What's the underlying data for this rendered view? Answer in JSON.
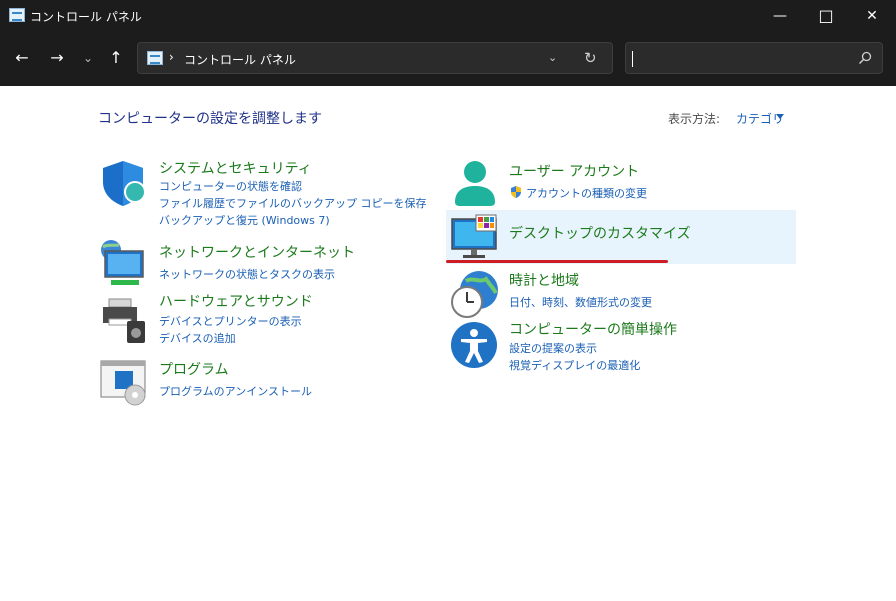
{
  "window": {
    "title": "コントロール パネル",
    "minimize_glyph": "—",
    "maximize_glyph": "□",
    "close_glyph": "✕"
  },
  "toolbar": {
    "back_glyph": "←",
    "forward_glyph": "→",
    "recent_glyph": "⌄",
    "up_glyph": "↑",
    "breadcrumb": "コントロール パネル",
    "breadcrumb_separator": "›",
    "dropdown_glyph": "⌄",
    "refresh_glyph": "↻",
    "search_value": ""
  },
  "content": {
    "heading": "コンピューターの設定を調整します",
    "view_by_label": "表示方法:",
    "view_by_value": "カテゴリ"
  },
  "categories_left": [
    {
      "title": "システムとセキュリティ",
      "icon": "shield-icon",
      "links": [
        "コンピューターの状態を確認",
        "ファイル履歴でファイルのバックアップ コピーを保存",
        "バックアップと復元 (Windows 7)"
      ]
    },
    {
      "title": "ネットワークとインターネット",
      "icon": "network-icon",
      "links": [
        "ネットワークの状態とタスクの表示"
      ]
    },
    {
      "title": "ハードウェアとサウンド",
      "icon": "printer-speaker-icon",
      "links": [
        "デバイスとプリンターの表示",
        "デバイスの追加"
      ]
    },
    {
      "title": "プログラム",
      "icon": "programs-icon",
      "links": [
        "プログラムのアンインストール"
      ]
    }
  ],
  "categories_right": [
    {
      "title": "ユーザー アカウント",
      "icon": "user-icon",
      "links": [
        "アカウントの種類の変更"
      ]
    },
    {
      "title": "デスクトップのカスタマイズ",
      "icon": "monitor-icon",
      "links": []
    },
    {
      "title": "時計と地域",
      "icon": "clock-globe-icon",
      "links": [
        "日付、時刻、数値形式の変更"
      ]
    },
    {
      "title": "コンピューターの簡単操作",
      "icon": "accessibility-icon",
      "links": [
        "設定の提案の表示",
        "視覚ディスプレイの最適化"
      ]
    }
  ],
  "colors": {
    "titlebar": "#1c1c1c",
    "category_title": "#1b7a1b",
    "link": "#1a5fb4",
    "heading": "#1e3287",
    "highlight": "#e8f4fd",
    "annotation_underline": "#cf1d26"
  }
}
